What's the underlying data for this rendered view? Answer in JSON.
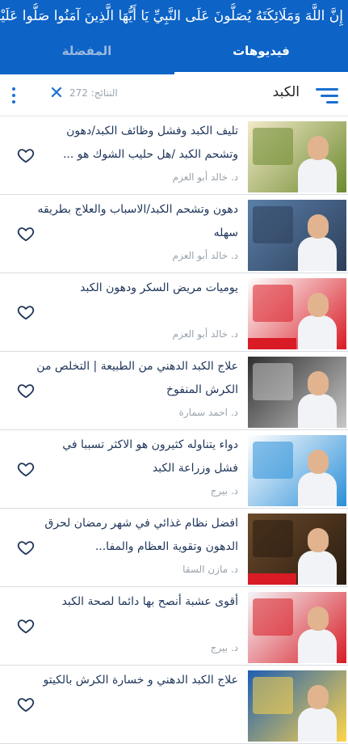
{
  "header": {
    "verse": "إِنَّ اللَّهَ وَمَلَائِكَتَهُ يُصَلُّونَ عَلَى النَّبِيِّ يَا أَيُّهَا الَّذِينَ آمَنُوا صَلُّوا عَلَيْهِ وَسَلِّمُوا",
    "tabs": [
      {
        "label": "فيديوهات",
        "active": true
      },
      {
        "label": "المفضلة",
        "active": false
      }
    ]
  },
  "search": {
    "query": "الكبد",
    "results_label": "النتائج: 272",
    "menu_icon": "hamburger-icon",
    "close_icon": "close-icon",
    "more_icon": "more-vertical-icon"
  },
  "colors": {
    "accent": "#0d63c6",
    "icon": "#1a6fd1",
    "title": "#1e3559",
    "muted": "#9aa3ad"
  },
  "videos": [
    {
      "title": "تليف الكبد وفشل وظائف الكبد/دهون وتشحم الكبد /هل حليب الشوك هو ...",
      "author": "د. خالد أبو العزم",
      "favorite": false
    },
    {
      "title": "دهون وتشحم الكبد/الاسباب والعلاج بطريقه سهله",
      "author": "د. خالد أبو العزم",
      "favorite": false
    },
    {
      "title": "يوميات مريض السكر ودهون الكبد",
      "author": "د. خالد أبو العزم",
      "favorite": false
    },
    {
      "title": "علاج الكبد الدهني من الطبيعة | التخلص من الكرش المنفوخ",
      "author": "د. احمد سمارة",
      "favorite": false
    },
    {
      "title": "دواء يتناوله كثيرون هو الاكثر تسببا في فشل وزراعة الكبد",
      "author": "د. بيرج",
      "favorite": false
    },
    {
      "title": "افضل نظام غذائي في شهر رمضان لحرق الدهون وتقوية العظام والمفا...",
      "author": "د. مازن السقا",
      "favorite": false
    },
    {
      "title": "أقوى عشبة أنصح بها دائما لصحة الكبد",
      "author": "د. بيرج",
      "favorite": false
    },
    {
      "title": "علاج الكبد الدهني و خسارة الكرش بالكيتو",
      "author": "",
      "favorite": false
    }
  ]
}
